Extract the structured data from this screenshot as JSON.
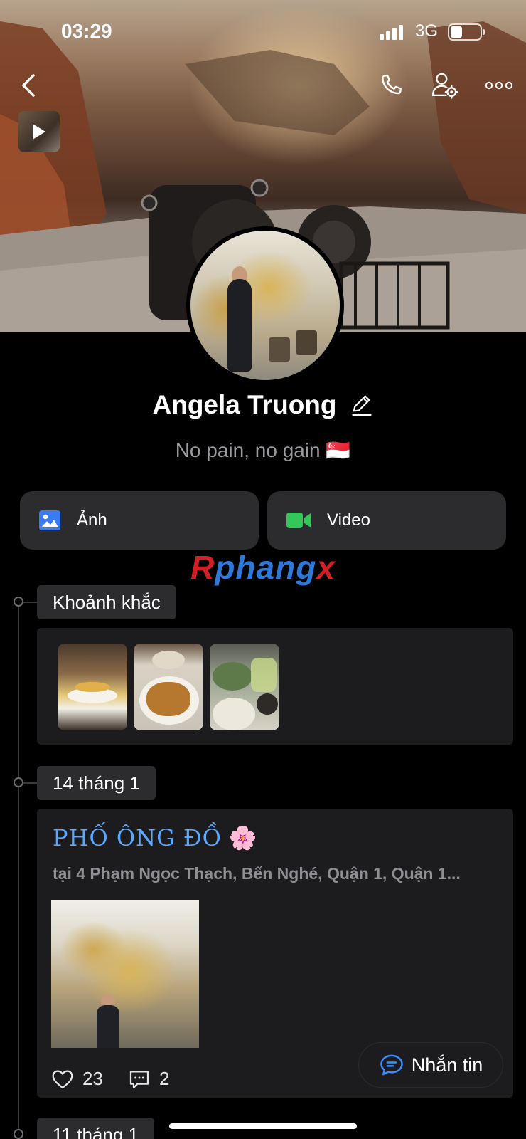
{
  "status_bar": {
    "time": "03:29",
    "network": "3G",
    "battery_level": 0.4
  },
  "header": {
    "back_icon": "chevron-left-icon",
    "call_icon": "phone-icon",
    "settings_icon": "user-gear-icon",
    "more_icon": "more-dots-icon"
  },
  "profile": {
    "name": "Angela Truong",
    "bio": "No pain, no gain 🇸🇬"
  },
  "media_buttons": [
    {
      "label": "Ảnh",
      "icon": "photo-icon",
      "color": "#3a7af2"
    },
    {
      "label": "Video",
      "icon": "video-camera-icon",
      "color": "#34c759"
    }
  ],
  "watermark": {
    "part1": "R",
    "part2": "phangx",
    "part3": "x"
  },
  "moments": {
    "label": "Khoảnh khắc",
    "count": 3
  },
  "posts": [
    {
      "date_label": "14 tháng 1",
      "title": "PHỐ ÔNG ĐỒ",
      "emoji": "🌸",
      "location": "tại 4 Phạm Ngọc Thạch, Bến Nghé, Quận 1, Quận 1...",
      "likes": "23",
      "comments": "2"
    }
  ],
  "next_section": {
    "date_label": "11 tháng 1"
  },
  "chat_button": {
    "label": "Nhắn tin"
  },
  "colors": {
    "accent": "#5aa8ff",
    "card": "#1c1c1e",
    "button": "#2c2c2e"
  }
}
